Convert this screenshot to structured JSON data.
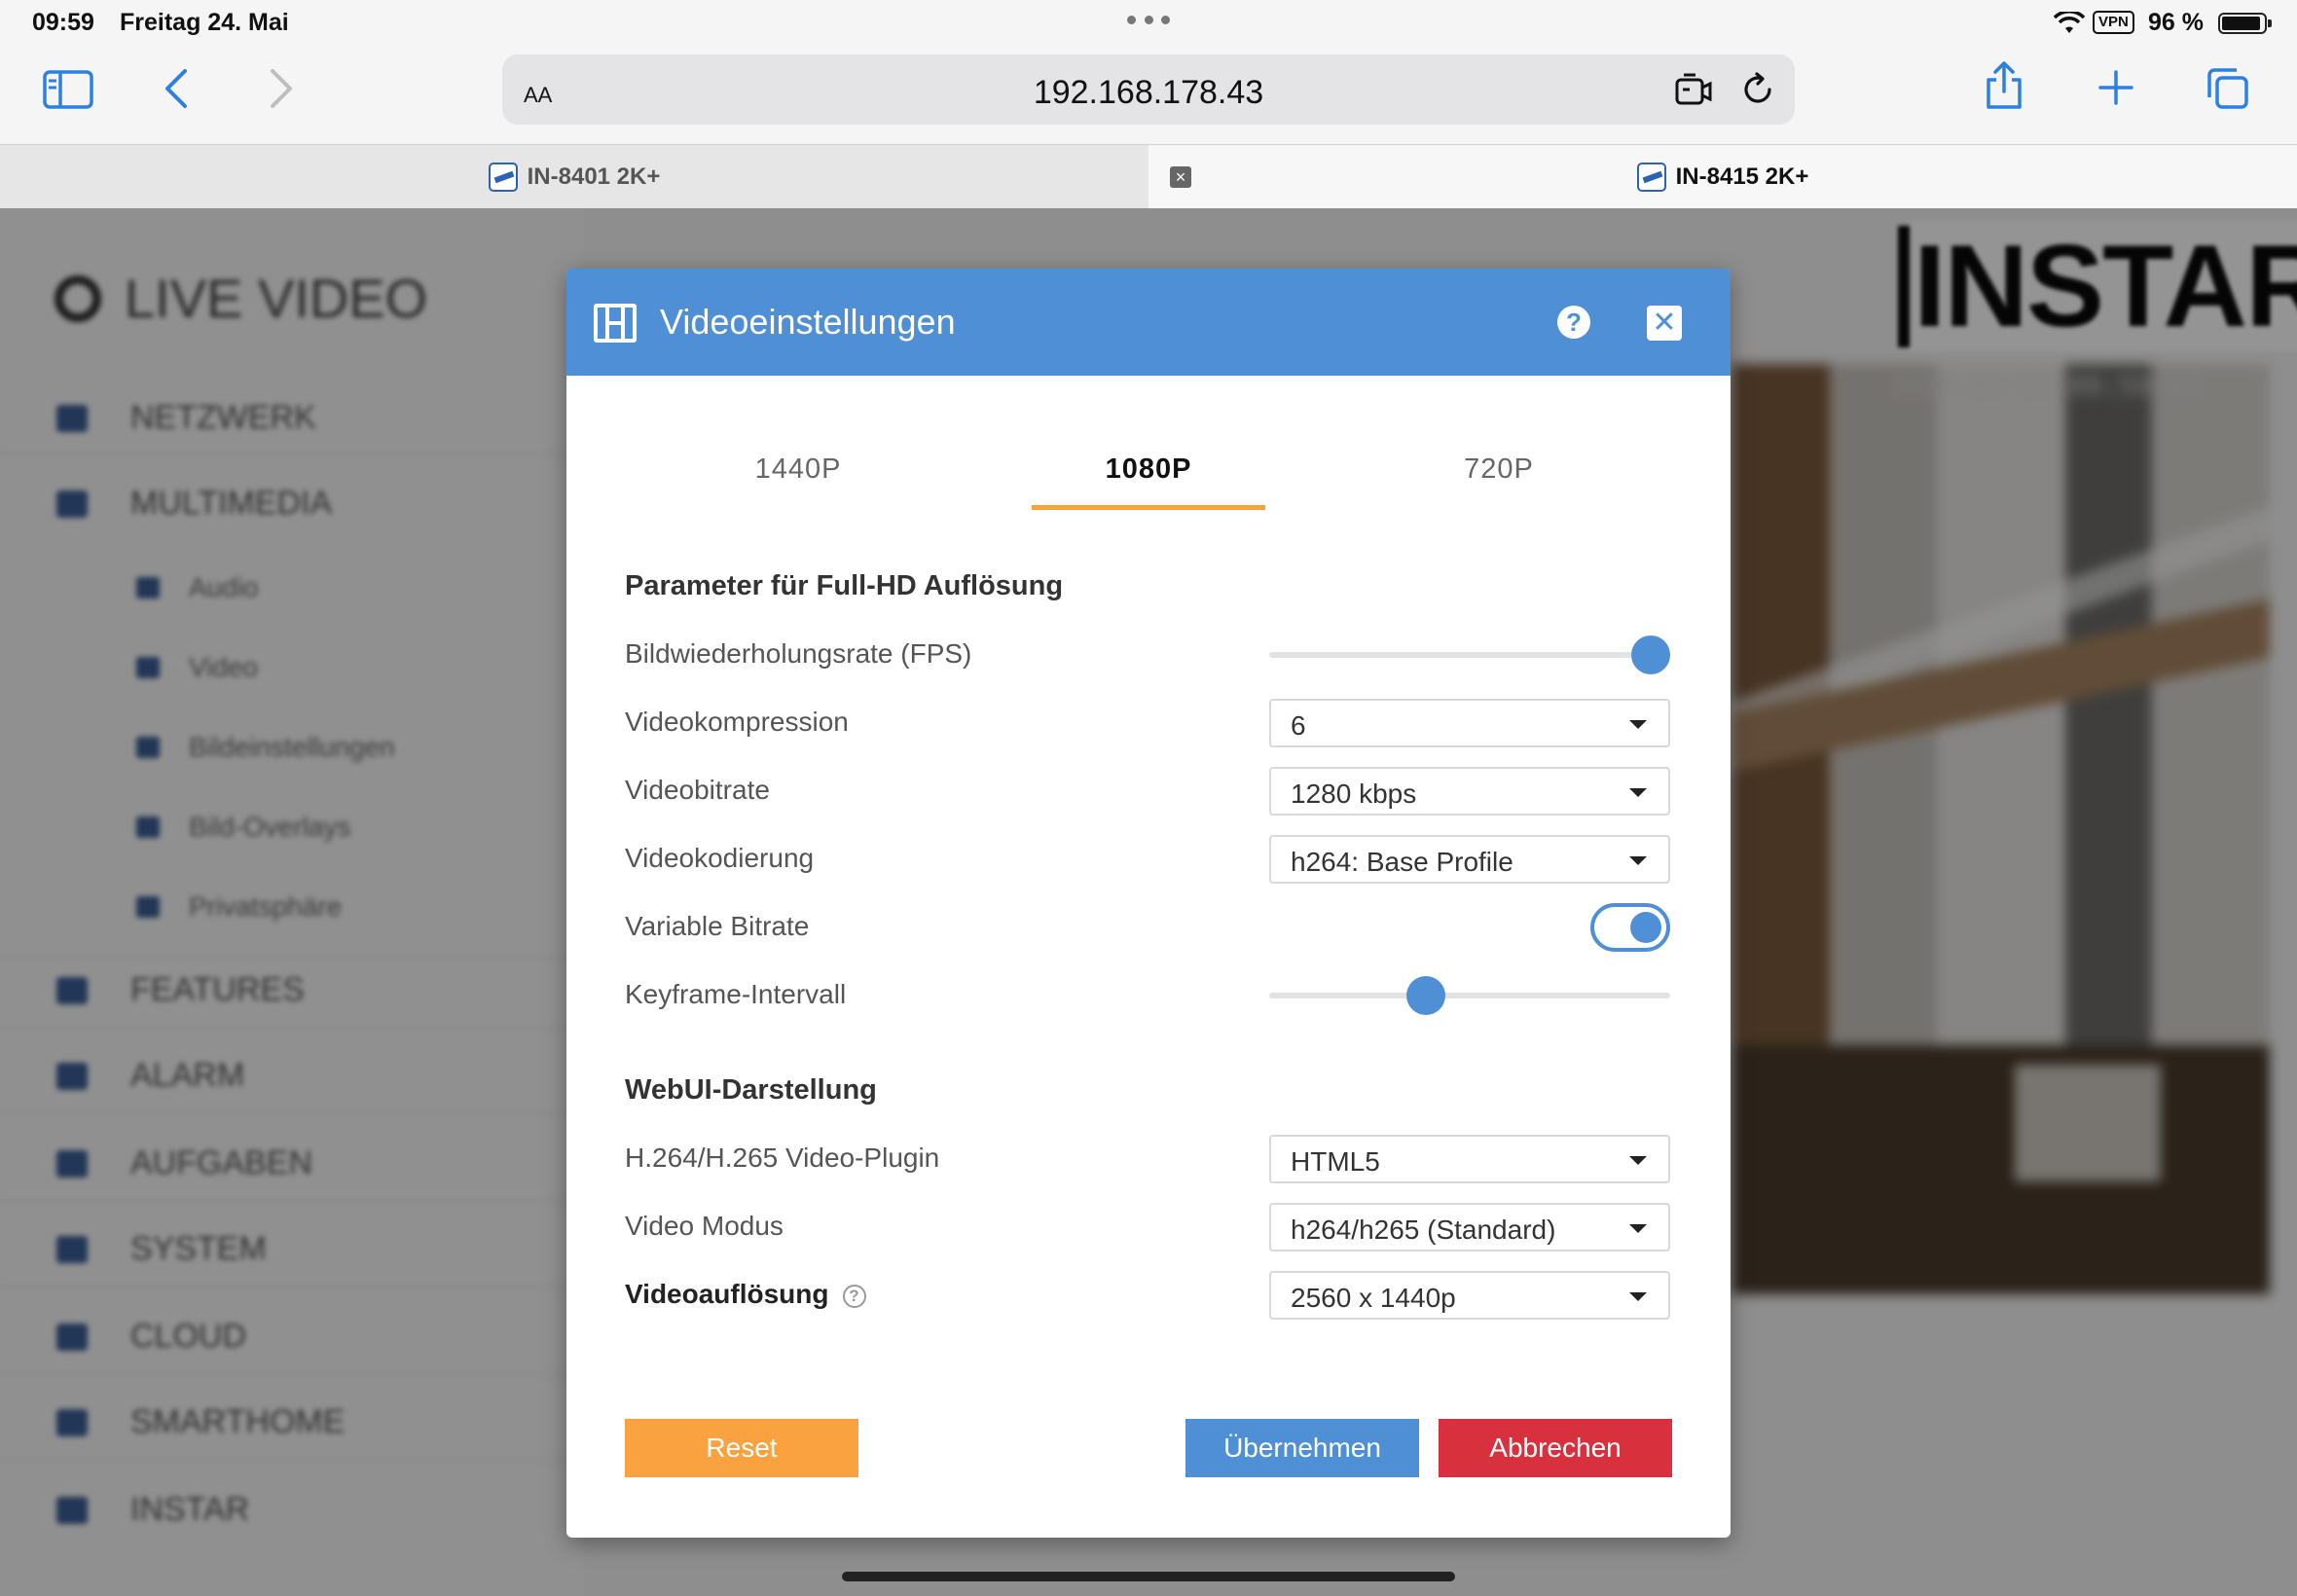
{
  "status_bar": {
    "time": "09:59",
    "date": "Freitag 24. Mai",
    "vpn": "VPN",
    "battery": "96 %"
  },
  "browser": {
    "url": "192.168.178.43",
    "text_size_label": "AA",
    "tabs": [
      {
        "label": "IN-8401 2K+",
        "active": false
      },
      {
        "label": "IN-8415 2K+",
        "active": true
      }
    ],
    "tab_close": "×"
  },
  "background_ui": {
    "title": "LIVE VIDEO",
    "menu": [
      "NETZWERK",
      "MULTIMEDIA",
      "FEATURES",
      "ALARM",
      "AUFGABEN",
      "SYSTEM",
      "CLOUD",
      "SMARTHOME",
      "INSTAR"
    ],
    "submenu": [
      "Audio",
      "Video",
      "Bildeinstellungen",
      "Bild-Overlays",
      "Privatsphäre"
    ],
    "brand_logo": "INSTAR",
    "timestamp": "2024-05-24 09:59:03"
  },
  "modal": {
    "title": "Videoeinstellungen",
    "help_glyph": "?",
    "close_glyph": "✕",
    "tabs": [
      "1440P",
      "1080P",
      "720P"
    ],
    "active_tab": "1080P",
    "section_params": "Parameter für Full-HD Auflösung",
    "fps": {
      "label": "Bildwiederholungsrate (FPS)",
      "level": 1.0
    },
    "compression": {
      "label": "Videokompression",
      "value": "6"
    },
    "bitrate": {
      "label": "Videobitrate",
      "value": "1280 kbps"
    },
    "encoding": {
      "label": "Videokodierung",
      "value": "h264: Base Profile"
    },
    "vbr": {
      "label": "Variable Bitrate",
      "on": true
    },
    "keyframe": {
      "label": "Keyframe-Intervall",
      "level": 0.38
    },
    "section_webui": "WebUI-Darstellung",
    "plugin": {
      "label": "H.264/H.265 Video-Plugin",
      "value": "HTML5"
    },
    "mode": {
      "label": "Video Modus",
      "value": "h264/h265 (Standard)"
    },
    "resolution": {
      "label": "Videoauflösung",
      "value": "2560 x 1440p",
      "help": "?"
    },
    "buttons": {
      "reset": "Reset",
      "apply": "Übernehmen",
      "cancel": "Abbrechen"
    }
  },
  "colors": {
    "accent": "#4f8fd6",
    "tab_underline": "#f7a33c",
    "reset": "#f9a23f",
    "cancel": "#d8313d"
  }
}
